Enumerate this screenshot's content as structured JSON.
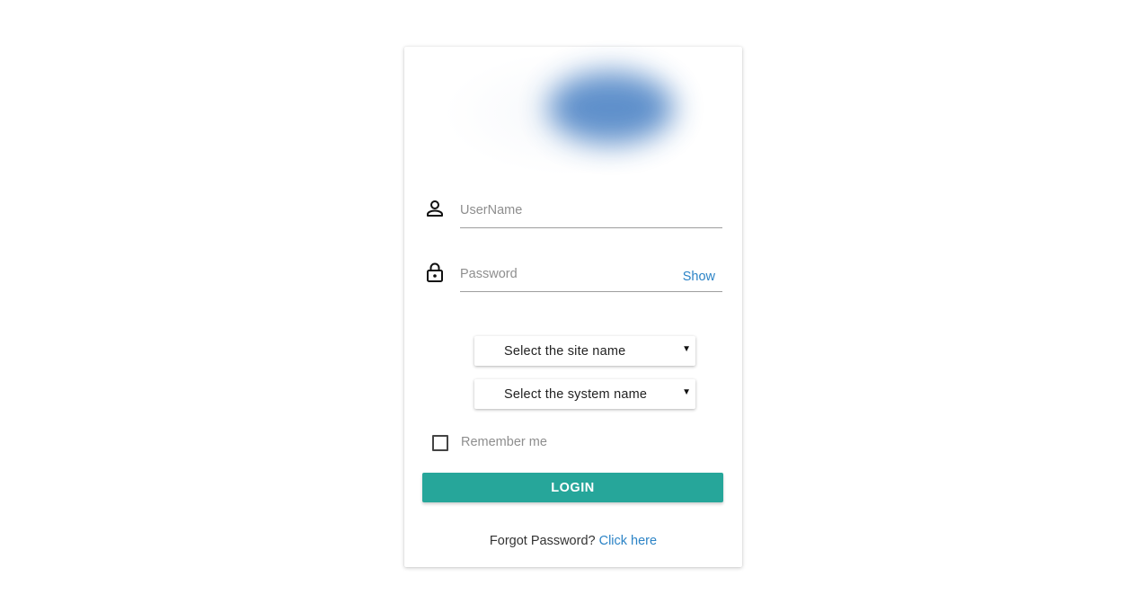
{
  "login_form": {
    "username": {
      "placeholder": "UserName",
      "value": "",
      "icon": "person-icon"
    },
    "password": {
      "placeholder": "Password",
      "value": "",
      "icon": "lock-icon",
      "toggle_label": "Show"
    },
    "site_select": {
      "selected": "Select the site name",
      "icon": "caret-down-icon"
    },
    "system_select": {
      "selected": "Select the system name",
      "icon": "caret-down-icon"
    },
    "remember_me": {
      "label": "Remember me",
      "checked": false
    },
    "login_button": {
      "label": "LOGIN"
    },
    "forgot": {
      "text": "Forgot Password?",
      "link_label": "Click here"
    }
  },
  "colors": {
    "primary_button": "#26a69a",
    "link": "#2b83c6",
    "placeholder": "#8e8e8e"
  }
}
